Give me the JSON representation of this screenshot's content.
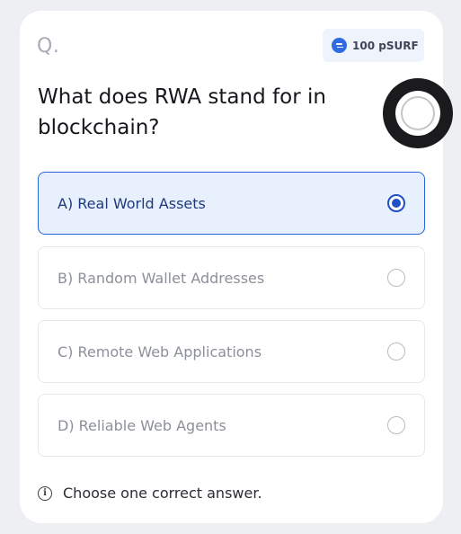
{
  "quiz": {
    "q_marker": "Q.",
    "reward": {
      "icon": "coin-icon",
      "text": "100 pSURF",
      "color": "#2f6be3"
    },
    "question": "What does RWA stand for in blockchain?",
    "options": [
      {
        "label": "A) Real World Assets",
        "selected": true
      },
      {
        "label": "B) Random Wallet Addresses",
        "selected": false
      },
      {
        "label": "C) Remote Web Applications",
        "selected": false
      },
      {
        "label": "D) Reliable Web Agents",
        "selected": false
      }
    ],
    "hint": {
      "icon": "info-icon",
      "text": "Choose one correct answer."
    },
    "accent_color": "#2b63d9",
    "selected_bg": "#e9f0fd"
  }
}
